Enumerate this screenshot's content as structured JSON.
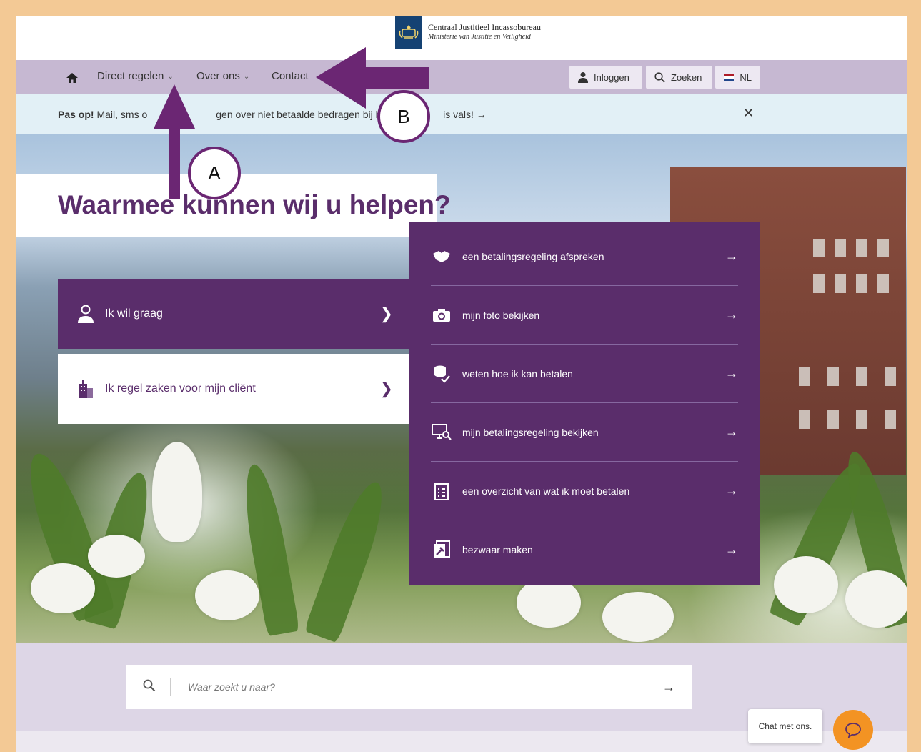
{
  "header": {
    "org_name": "Centraal Justitieel Incassobureau",
    "ministry": "Ministerie van Justitie en Veiligheid"
  },
  "nav": {
    "home_icon": "home-icon",
    "items": [
      {
        "label": "Direct regelen"
      },
      {
        "label": "Over ons"
      },
      {
        "label": "Contact"
      }
    ],
    "login_label": "Inloggen",
    "search_label": "Zoeken",
    "language_label": "NL"
  },
  "alert": {
    "prefix": "Pas op!",
    "text_visible_1": " Mail, sms o",
    "text_visible_2": "gen over niet betaalde bedragen bij het",
    "text_visible_3": "is vals! →",
    "close_icon": "close-icon"
  },
  "hero": {
    "title": "Waarmee kunnen wij u helpen?",
    "choices": [
      {
        "label": "Ik wil graag",
        "icon": "person-icon"
      },
      {
        "label": "Ik regel zaken voor mijn cliënt",
        "icon": "building-icon"
      }
    ]
  },
  "menu": {
    "items": [
      {
        "label": "een betalingsregeling afspreken",
        "icon": "handshake-icon"
      },
      {
        "label": "mijn foto bekijken",
        "icon": "camera-icon"
      },
      {
        "label": "weten hoe ik kan betalen",
        "icon": "coins-icon"
      },
      {
        "label": "mijn betalingsregeling bekijken",
        "icon": "monitor-search-icon"
      },
      {
        "label": "een overzicht van wat ik moet betalen",
        "icon": "clipboard-icon"
      },
      {
        "label": "bezwaar maken",
        "icon": "gavel-document-icon"
      }
    ]
  },
  "search": {
    "placeholder": "Waar zoekt u naar?"
  },
  "chat": {
    "label": "Chat met ons."
  },
  "annotations": {
    "a_label": "A",
    "b_label": "B",
    "color": "#6b2673"
  },
  "colors": {
    "brand_purple": "#5a2d6b",
    "nav_bg": "#c6b8d2",
    "alert_bg": "#e2f0f6",
    "chat_orange": "#f39323",
    "frame_border": "#f3c995"
  }
}
